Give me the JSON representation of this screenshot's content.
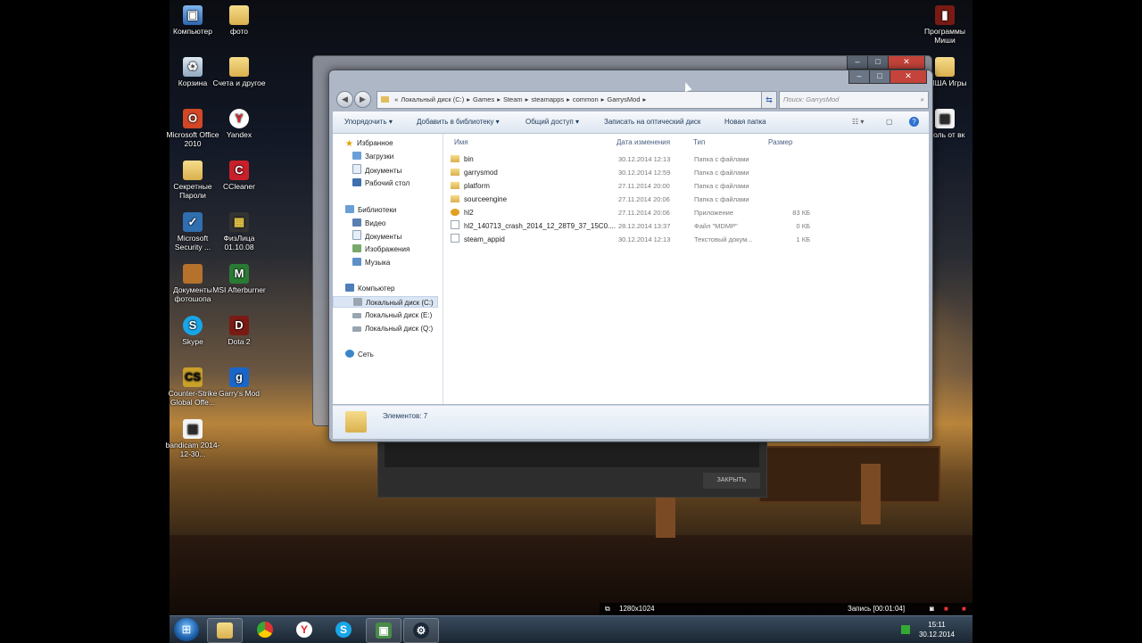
{
  "desktop": {
    "icons_left": [
      {
        "label": "Компьютер",
        "glyph": "▣",
        "cls": "ico-pc"
      },
      {
        "label": "Корзина",
        "glyph": "♻",
        "cls": "ico-bin"
      },
      {
        "label": "Microsoft Office 2010",
        "glyph": "O",
        "cls": "ico-office"
      },
      {
        "label": "Секретные Пароли",
        "glyph": "",
        "cls": "ico-folder"
      },
      {
        "label": "Microsoft Security ...",
        "glyph": "✓",
        "cls": "ico-sec"
      },
      {
        "label": "Документы фотошопа",
        "glyph": "",
        "cls": "ico-ps"
      },
      {
        "label": "Skype",
        "glyph": "S",
        "cls": "ico-skype"
      },
      {
        "label": "Counter-Strike Global Offe...",
        "glyph": "CS",
        "cls": "ico-cs"
      },
      {
        "label": "bandicam 2014-12-30...",
        "glyph": "▤",
        "cls": "ico-doc"
      }
    ],
    "icons_right_col": [
      {
        "label": "фото",
        "glyph": "",
        "cls": "ico-folder"
      },
      {
        "label": "Счета и другое",
        "glyph": "",
        "cls": "ico-folder"
      },
      {
        "label": "Yandex",
        "glyph": "Y",
        "cls": "ico-yandex"
      },
      {
        "label": "CCleaner",
        "glyph": "C",
        "cls": "ico-cc"
      },
      {
        "label": "ФизЛица 01.10.08",
        "glyph": "▦",
        "cls": "ico-film"
      },
      {
        "label": "MSI Afterburner",
        "glyph": "M",
        "cls": "ico-msi"
      },
      {
        "label": "Dota 2",
        "glyph": "D",
        "cls": "ico-dota"
      },
      {
        "label": "Garry's Mod",
        "glyph": "g",
        "cls": "ico-gmod"
      }
    ],
    "icons_far_right": [
      {
        "label": "Программы Миши",
        "glyph": "▮",
        "cls": "ico-dota"
      },
      {
        "label": "МИША Игры",
        "glyph": "",
        "cls": "ico-folder"
      },
      {
        "label": "ароль от вк",
        "glyph": "▤",
        "cls": "ico-doc"
      }
    ]
  },
  "steam_dialog": {
    "close_label": "ЗАКРЫТЬ"
  },
  "explorer": {
    "title_buttons": {
      "minimize": "–",
      "maximize": "□",
      "close": "✕"
    },
    "breadcrumb": [
      "«",
      "Локальный диск (C:)",
      "▸",
      "Games",
      "▸",
      "Steam",
      "▸",
      "steamapps",
      "▸",
      "common",
      "▸",
      "GarrysMod",
      "▸"
    ],
    "search_placeholder": "Поиск: GarrysMod",
    "toolbar": {
      "organize": "Упорядочить ▾",
      "add_to_library": "Добавить в библиотеку ▾",
      "share": "Общий доступ ▾",
      "burn": "Записать на оптический диск",
      "new_folder": "Новая папка"
    },
    "nav": {
      "favorites": "Избранное",
      "downloads": "Загрузки",
      "documents": "Документы",
      "desktop": "Рабочий стол",
      "libraries": "Библиотеки",
      "video": "Видео",
      "lib_documents": "Документы",
      "images": "Изображения",
      "music": "Музыка",
      "computer": "Компьютер",
      "drive_c": "Локальный диск (C:)",
      "drive_e": "Локальный диск (E:)",
      "drive_q": "Локальный диск (Q:)",
      "network": "Сеть"
    },
    "columns": {
      "name": "Имя",
      "date": "Дата изменения",
      "type": "Тип",
      "size": "Размер"
    },
    "files": [
      {
        "name": "bin",
        "date": "30.12.2014 12:13",
        "type": "Папка с файлами",
        "size": "",
        "kind": "folder"
      },
      {
        "name": "garrysmod",
        "date": "30.12.2014 12:59",
        "type": "Папка с файлами",
        "size": "",
        "kind": "folder"
      },
      {
        "name": "platform",
        "date": "27.11.2014 20:00",
        "type": "Папка с файлами",
        "size": "",
        "kind": "folder"
      },
      {
        "name": "sourceengine",
        "date": "27.11.2014 20:06",
        "type": "Папка с файлами",
        "size": "",
        "kind": "folder"
      },
      {
        "name": "hl2",
        "date": "27.11.2014 20:06",
        "type": "Приложение",
        "size": "83 КБ",
        "kind": "app"
      },
      {
        "name": "hl2_140713_crash_2014_12_28T9_37_15C0....",
        "date": "28.12.2014 13:37",
        "type": "Файл \"MDMP\"",
        "size": "0 КБ",
        "kind": "file"
      },
      {
        "name": "steam_appid",
        "date": "30.12.2014 12:13",
        "type": "Текстовый докум...",
        "size": "1 КБ",
        "kind": "file"
      }
    ],
    "status": "Элементов: 7"
  },
  "recorder": {
    "resolution": "1280x1024",
    "recording": "Запись [00:01:04]"
  },
  "taskbar": {
    "clock_time": "15:11",
    "clock_date": "30.12.2014"
  }
}
